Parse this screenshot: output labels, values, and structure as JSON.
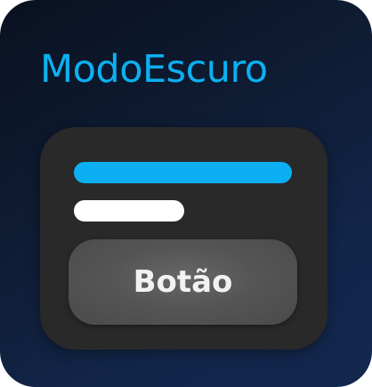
{
  "header": {
    "title": "ModoEscuro"
  },
  "card": {
    "button_label": "Botão"
  },
  "colors": {
    "background_top": "#0a1120",
    "background_bottom": "#13284e",
    "accent": "#0cb0f2",
    "card": "#292929",
    "bar_light": "#ffffff",
    "button": "#555555",
    "button_text": "#f2f2f2"
  }
}
